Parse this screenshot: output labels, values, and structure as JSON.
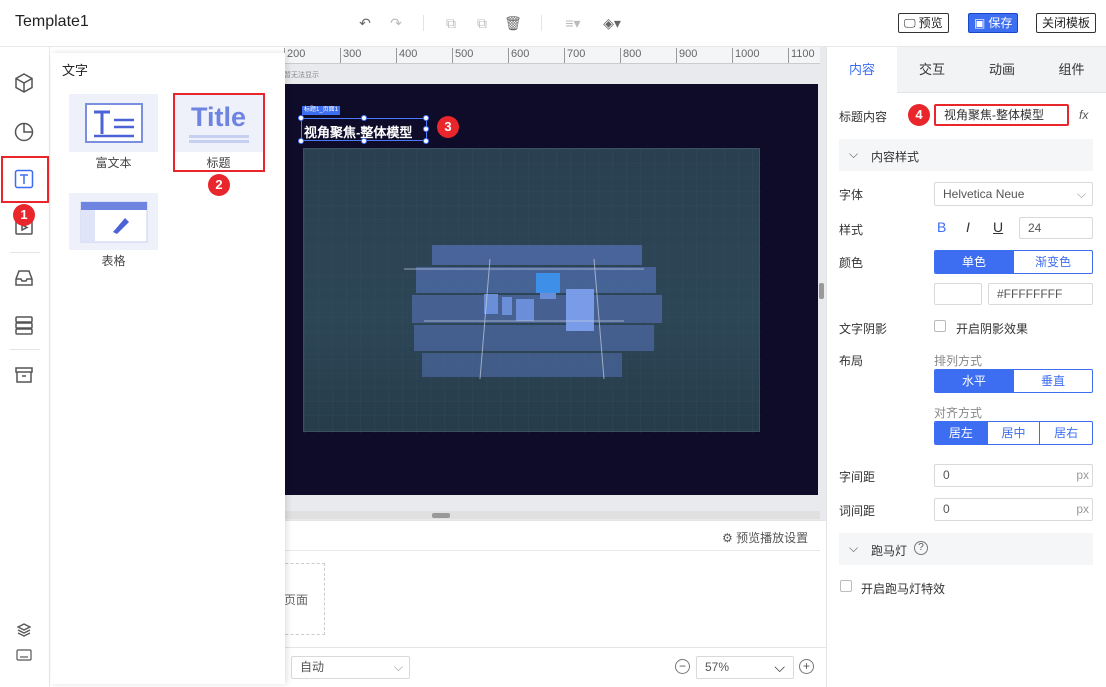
{
  "app": {
    "title": "Template1"
  },
  "toolbar": {
    "preview_label": "预览",
    "save_label": "保存",
    "close_label": "关闭模板"
  },
  "left_panel": {
    "title": "文字",
    "items": [
      {
        "label": "富文本"
      },
      {
        "label": "标题",
        "thumb_text": "Title"
      },
      {
        "label": "表格"
      }
    ]
  },
  "canvas": {
    "ruler_ticks": [
      "200",
      "300",
      "400",
      "500",
      "600",
      "700",
      "800",
      "900",
      "1000",
      "1100"
    ],
    "element_tag": "标题1_页面1",
    "element_text": "视角聚焦-整体模型",
    "hint": "暂无法显示"
  },
  "bottom": {
    "playback_settings": "预览播放设置",
    "page_label": "页面",
    "auto_select": "自动",
    "zoom": "57%"
  },
  "right_panel": {
    "tabs": [
      "内容",
      "交互",
      "动画",
      "组件"
    ],
    "title_content_label": "标题内容",
    "title_content_value": "视角聚焦-整体模型",
    "fx": "fx",
    "content_style_section": "内容样式",
    "font_label": "字体",
    "font_value": "Helvetica Neue",
    "style_label": "样式",
    "bold": "B",
    "italic": "I",
    "underline": "U",
    "font_size": "24",
    "color_label": "颜色",
    "color_single": "单色",
    "color_gradient": "渐变色",
    "color_hex": "#FFFFFFFF",
    "shadow_label": "文字阴影",
    "shadow_check": "开启阴影效果",
    "layout_label": "布局",
    "arrange_label": "排列方式",
    "arrange_h": "水平",
    "arrange_v": "垂直",
    "align_label": "对齐方式",
    "align_left": "居左",
    "align_center": "居中",
    "align_right": "居右",
    "letter_spacing_label": "字间距",
    "letter_spacing_value": "0",
    "word_spacing_label": "词间距",
    "word_spacing_value": "0",
    "unit_px": "px",
    "marquee_section": "跑马灯",
    "marquee_check": "开启跑马灯特效"
  },
  "annotations": [
    "1",
    "2",
    "3",
    "4"
  ],
  "colors": {
    "accent": "#3d6ef1",
    "highlight": "#e8262c",
    "stage_bg": "#0f0c2a"
  }
}
